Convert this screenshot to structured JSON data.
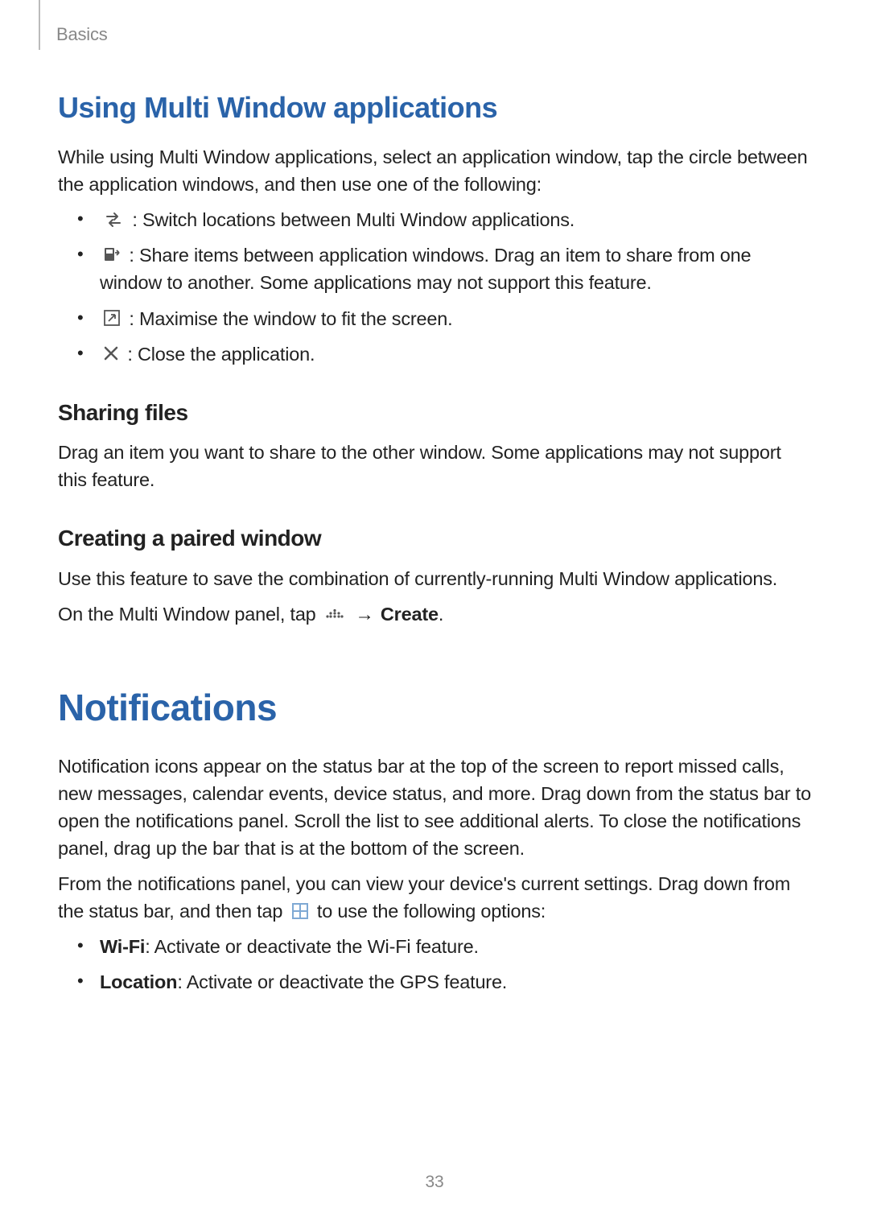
{
  "header": {
    "section_label": "Basics"
  },
  "section1": {
    "title": "Using Multi Window applications",
    "intro": "While using Multi Window applications, select an application window, tap the circle between the application windows, and then use one of the following:",
    "items": [
      {
        "icon": "swap-icon",
        "text": ": Switch locations between Multi Window applications."
      },
      {
        "icon": "share-drag-icon",
        "text": ": Share items between application windows. Drag an item to share from one window to another. Some applications may not support this feature."
      },
      {
        "icon": "maximize-icon",
        "text": ": Maximise the window to fit the screen."
      },
      {
        "icon": "close-icon",
        "text": ": Close the application."
      }
    ]
  },
  "sharing": {
    "title": "Sharing files",
    "text": "Drag an item you want to share to the other window. Some applications may not support this feature."
  },
  "paired": {
    "title": "Creating a paired window",
    "p1": "Use this feature to save the combination of currently-running Multi Window applications.",
    "p2_pre": "On the Multi Window panel, tap ",
    "p2_arrow": "→",
    "p2_create": "Create",
    "p2_post": "."
  },
  "notifications": {
    "title": "Notifications",
    "p1": "Notification icons appear on the status bar at the top of the screen to report missed calls, new messages, calendar events, device status, and more. Drag down from the status bar to open the notifications panel. Scroll the list to see additional alerts. To close the notifications panel, drag up the bar that is at the bottom of the screen.",
    "p2_pre": "From the notifications panel, you can view your device's current settings. Drag down from the status bar, and then tap ",
    "p2_post": " to use the following options:",
    "items": [
      {
        "bold": "Wi-Fi",
        "text": ": Activate or deactivate the Wi-Fi feature."
      },
      {
        "bold": "Location",
        "text": ": Activate or deactivate the GPS feature."
      }
    ]
  },
  "page_number": "33"
}
